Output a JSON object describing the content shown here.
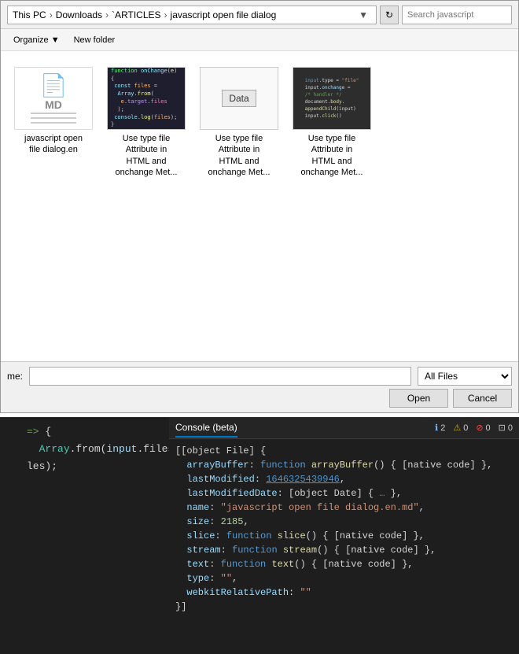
{
  "dialog": {
    "title": "javascript open file dialog",
    "breadcrumb": {
      "thispc": "This PC",
      "downloads": "Downloads",
      "articles": "`ARTICLES",
      "current": "javascript open file dialog"
    },
    "search_placeholder": "Search javascript",
    "toolbar": {
      "buttons": [
        "Organize ▼",
        "New folder"
      ]
    },
    "files": [
      {
        "id": "file1",
        "name": "javascript open file dialog.en",
        "label": "javascript open\nfile dialog.en",
        "type": "md"
      },
      {
        "id": "file2",
        "name": "Use type file Attribute in HTML and onchange Met...",
        "label": "Use type file\nAttribute in\nHTML and\nonchange Met...",
        "type": "dark-code"
      },
      {
        "id": "file3",
        "name": "Use type file Attribute in HTML and onchange Met...",
        "label": "Use type file\nAttribute in\nHTML and\nonchange Met...",
        "type": "data-thumb"
      },
      {
        "id": "file4",
        "name": "Use type file Attribute in HTML and onchange Met...",
        "label": "Use type file\nAttribute in\nHTML and\nonchange Met...",
        "type": "dark2"
      }
    ],
    "bottom": {
      "filename_label": "me:",
      "filename_value": "",
      "filetype_label": "All Files",
      "open_btn": "Open",
      "cancel_btn": "Cancel"
    }
  },
  "editor": {
    "lines": [
      {
        "num": "",
        "tokens": [
          {
            "text": "=> {",
            "class": "c-white"
          }
        ]
      },
      {
        "num": "",
        "tokens": [
          {
            "text": "  ",
            "class": "c-white"
          },
          {
            "text": "Array",
            "class": "c-cyan"
          },
          {
            "text": ".from(",
            "class": "c-white"
          },
          {
            "text": "input",
            "class": "c-lightblue"
          },
          {
            "text": ".files);",
            "class": "c-white"
          }
        ]
      },
      {
        "num": "",
        "tokens": [
          {
            "text": "les);",
            "class": "c-white"
          }
        ]
      }
    ]
  },
  "console": {
    "tabs": [
      "Console (beta)"
    ],
    "indicators": {
      "info": "2",
      "warn": "0",
      "error": "0",
      "other": "0"
    },
    "output": [
      "[[object File] {",
      "  arrayBuffer: function arrayBuffer() { [native code] },",
      "  lastModified: 1646325439946,",
      "  lastModifiedDate: [object Date] {  },",
      "  name: \"javascript open file dialog.en.md\",",
      "  size: 2185,",
      "  slice: function slice() { [native code] },",
      "  stream: function stream() { [native code] },",
      "  text: function text() { [native code] },",
      "  type: \"\",",
      "  webkitRelativePath: \"\"",
      "}]"
    ]
  }
}
